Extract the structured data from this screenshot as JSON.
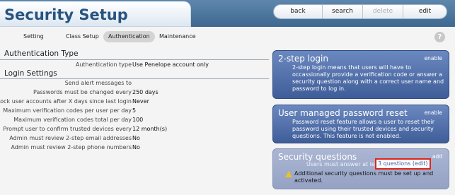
{
  "header": {
    "title": "Security Setup",
    "toolbar": [
      {
        "label": "back",
        "enabled": true
      },
      {
        "label": "search",
        "enabled": true
      },
      {
        "label": "delete",
        "enabled": false
      },
      {
        "label": "edit",
        "enabled": true
      }
    ]
  },
  "nav": {
    "tabs": [
      {
        "label": "Setting"
      },
      {
        "label": "Class Setup"
      },
      {
        "label": "Authentication",
        "active": true
      },
      {
        "label": "Maintenance"
      }
    ],
    "help_icon": "?"
  },
  "auth_type": {
    "heading": "Authentication Type",
    "label": "Authentication type",
    "value": "Use Penelope account only"
  },
  "login": {
    "heading": "Login Settings",
    "rows": [
      {
        "label": "Send alert messages to",
        "value": ""
      },
      {
        "label": "Passwords must be changed every",
        "value": "250 days"
      },
      {
        "label": "Lock user accounts after X days since last login",
        "value": "Never"
      },
      {
        "label": "Maximum verification codes per user per day",
        "value": "5"
      },
      {
        "label": "Maximum verification codes total per day",
        "value": "100"
      },
      {
        "label": "Prompt user to confirm trusted devices every",
        "value": "12 month(s)"
      },
      {
        "label": "Admin must review 2-step email addresses",
        "value": "No"
      },
      {
        "label": "Admin must review 2-step phone numbers",
        "value": "No"
      }
    ]
  },
  "panels": {
    "two_step": {
      "title": "2-step login",
      "action": "enable",
      "body": "2-step login means that users will have to occassionally provide a verification code or answer a security question along with a correct user name and password to log in."
    },
    "user_reset": {
      "title": "User managed password reset",
      "action": "enable",
      "body": "Password reset feature allows a user to reset their password using their trusted devices and security questions. This feature is not enabled."
    },
    "security_questions": {
      "title": "Security questions",
      "action": "add",
      "line1": "Users must answer at leas",
      "edit_link": "3 questions (edit)",
      "warning": "Additional security questions must be set up and activated."
    }
  },
  "colors": {
    "header_blue": "#3e6890",
    "panel_blue": "#3f5d98",
    "panel_light": "#95a2c4",
    "highlight_red": "#e0241b"
  }
}
